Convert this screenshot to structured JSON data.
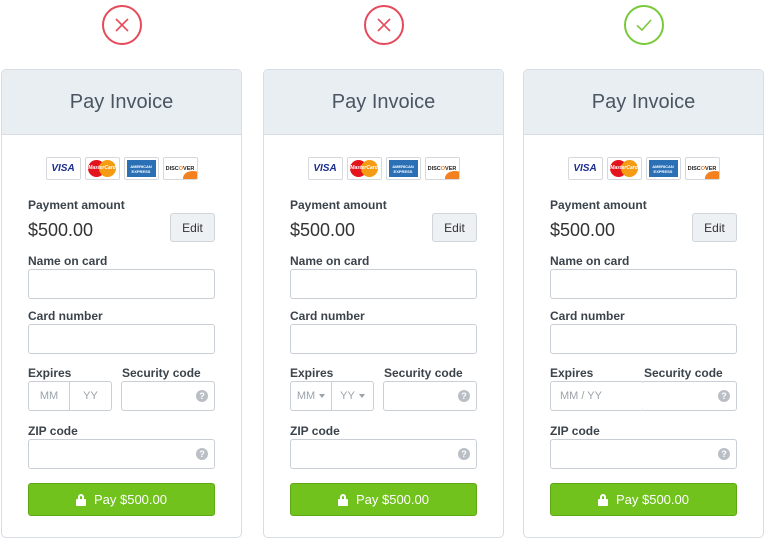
{
  "colors": {
    "bad": "#e64a5a",
    "good": "#79c93a",
    "pay_button": "#71c21d"
  },
  "verdicts": [
    {
      "icon": "x-circle-icon",
      "meaning": "bad"
    },
    {
      "icon": "x-circle-icon",
      "meaning": "bad"
    },
    {
      "icon": "check-circle-icon",
      "meaning": "good"
    }
  ],
  "cards": [
    {
      "title": "Pay Invoice",
      "card_logos": [
        "visa-logo",
        "mastercard-logo",
        "amex-logo",
        "discover-logo"
      ],
      "payment_amount_label": "Payment amount",
      "amount": "$500.00",
      "edit_label": "Edit",
      "name_label": "Name on card",
      "card_number_label": "Card number",
      "expires_label": "Expires",
      "security_label": "Security code",
      "expires_style": "two-text-fields",
      "expires_month_placeholder": "MM",
      "expires_year_placeholder": "YY",
      "zip_label": "ZIP code",
      "pay_label": "Pay $500.00"
    },
    {
      "title": "Pay Invoice",
      "card_logos": [
        "visa-logo",
        "mastercard-logo",
        "amex-logo",
        "discover-logo"
      ],
      "payment_amount_label": "Payment amount",
      "amount": "$500.00",
      "edit_label": "Edit",
      "name_label": "Name on card",
      "card_number_label": "Card number",
      "expires_label": "Expires",
      "security_label": "Security code",
      "expires_style": "two-dropdowns",
      "expires_month_placeholder": "MM",
      "expires_year_placeholder": "YY",
      "zip_label": "ZIP code",
      "pay_label": "Pay $500.00"
    },
    {
      "title": "Pay Invoice",
      "card_logos": [
        "visa-logo",
        "mastercard-logo",
        "amex-logo",
        "discover-logo"
      ],
      "payment_amount_label": "Payment amount",
      "amount": "$500.00",
      "edit_label": "Edit",
      "name_label": "Name on card",
      "card_number_label": "Card number",
      "expires_label": "Expires",
      "security_label": "Security code",
      "expires_style": "single-field",
      "expires_placeholder": "MM / YY",
      "zip_label": "ZIP code",
      "pay_label": "Pay $500.00"
    }
  ],
  "logo_text": {
    "visa": "VISA",
    "mastercard": "MasterCard",
    "amex_line1": "AMERICAN",
    "amex_line2": "EXPRESS",
    "discover_a": "DISC",
    "discover_o": "O",
    "discover_b": "VER"
  },
  "help_glyph": "?"
}
